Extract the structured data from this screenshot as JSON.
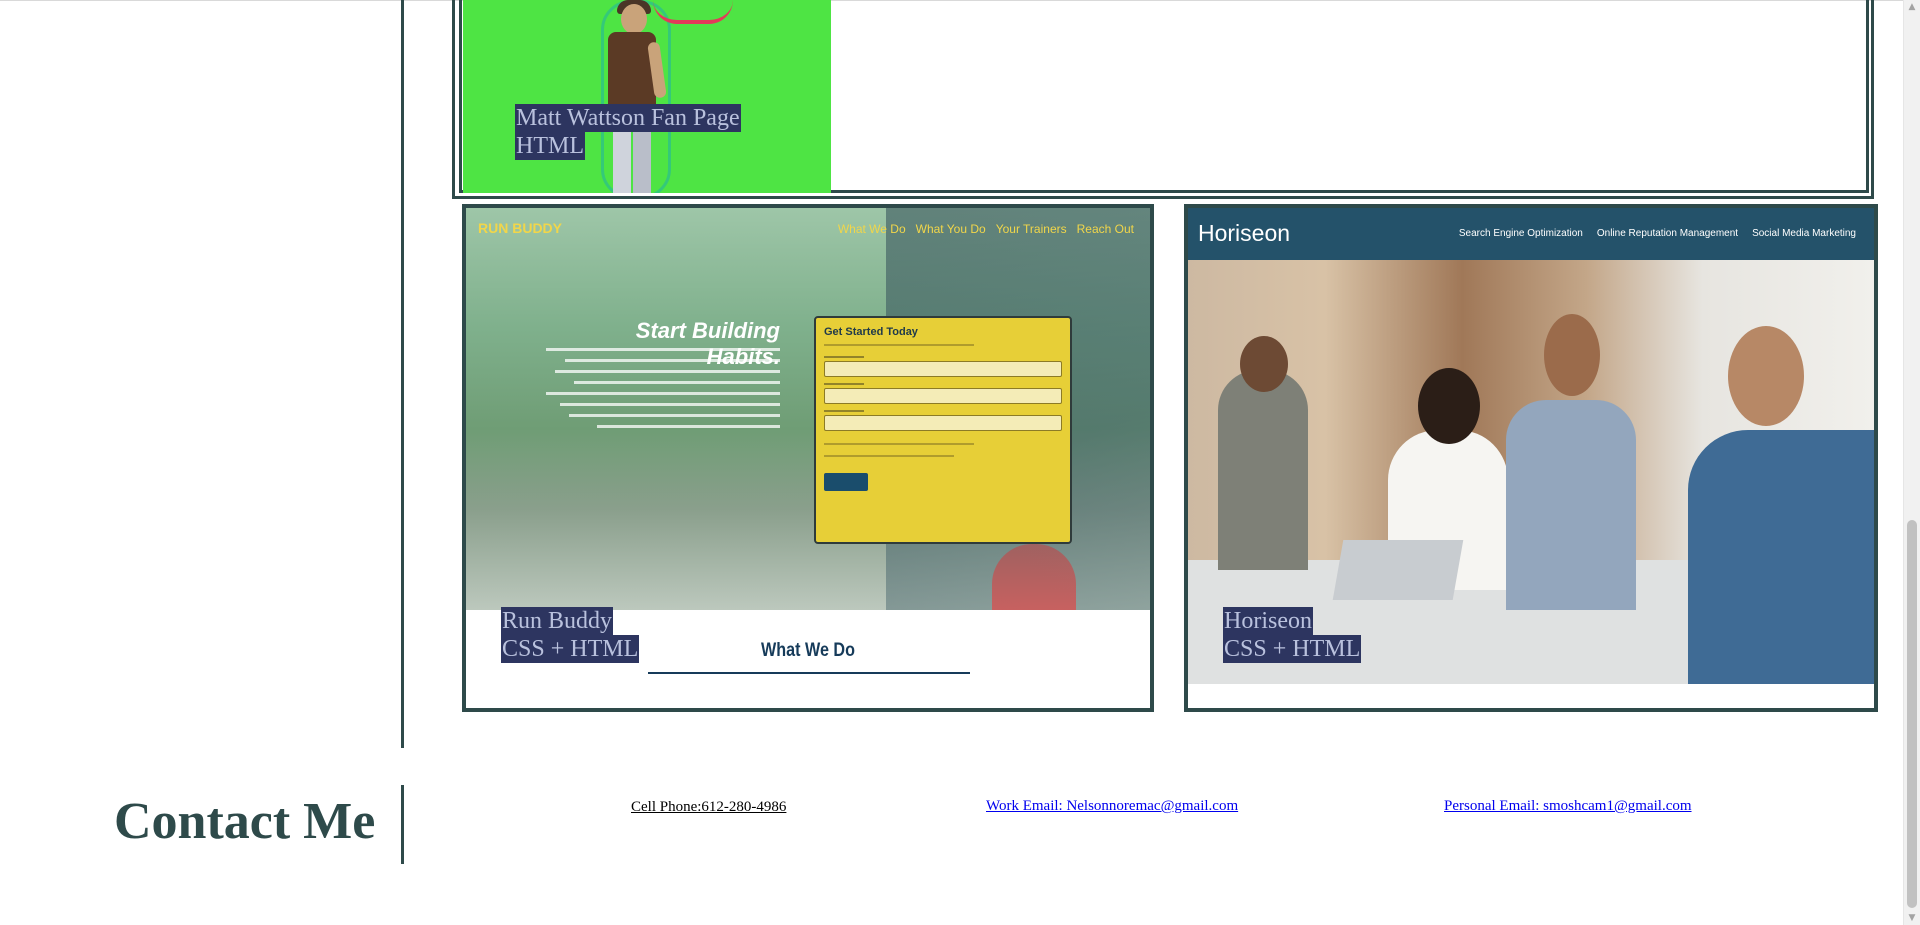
{
  "projects": [
    {
      "title": "Matt Wattson Fan Page",
      "tech": "HTML"
    },
    {
      "title": "Run Buddy",
      "tech": "CSS + HTML",
      "preview": {
        "logo": "RUN BUDDY",
        "nav": [
          "What We Do",
          "What You Do",
          "Your Trainers",
          "Reach Out"
        ],
        "headline": "Start Building Habits.",
        "form_title": "Get Started Today",
        "section_heading": "What We Do"
      }
    },
    {
      "title": "Horiseon",
      "tech": "CSS + HTML",
      "preview": {
        "logo": "Horiseon",
        "nav": [
          "Search Engine Optimization",
          "Online Reputation Management",
          "Social Media Marketing"
        ]
      }
    }
  ],
  "contact": {
    "heading": "Contact Me",
    "cell_phone": "Cell Phone:612-280-4986",
    "work_email": "Work Email: Nelsonnoremac@gmail.com",
    "personal_email": "Personal Email: smoshcam1@gmail.com"
  },
  "colors": {
    "accent": "#2e4a4a",
    "caption_bg": "#2d3560",
    "caption_text": "#b9c1dd",
    "link": "#0000ee"
  }
}
